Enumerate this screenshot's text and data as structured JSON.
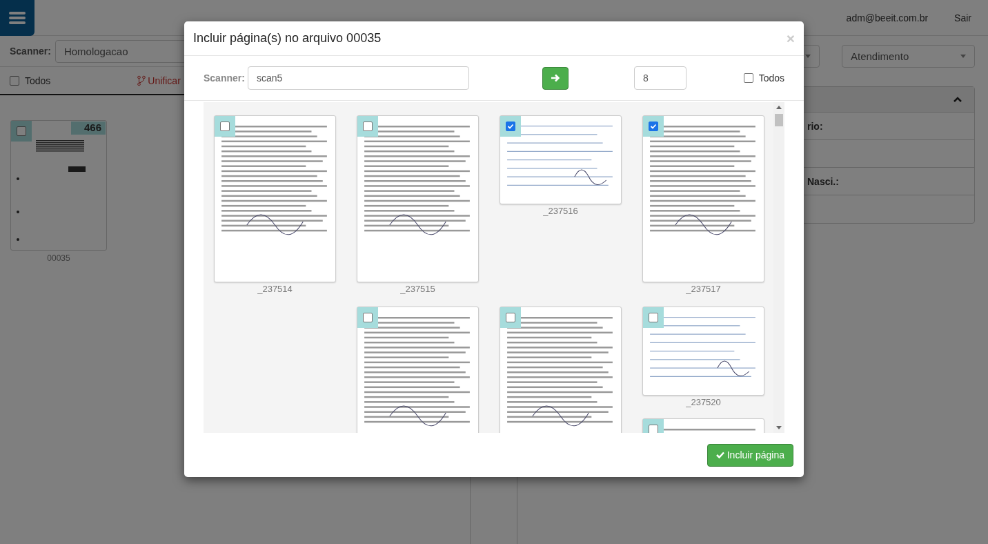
{
  "header": {
    "user": "adm@beeit.com.br",
    "logout": "Sair"
  },
  "left": {
    "scanner_label": "Scanner:",
    "scanner_value": "Homologacao",
    "select_all": {
      "label": "Todos",
      "checked": false
    },
    "merge_link": "Unificar",
    "files": [
      {
        "count": "466",
        "label": "00035",
        "checked": false
      }
    ]
  },
  "right": {
    "select_2": "Atendimento",
    "panel_rows": [
      "rio:",
      "",
      "Nasci.:",
      ""
    ]
  },
  "modal": {
    "title": "Incluir página(s) no arquivo 00035",
    "close": "×",
    "scanner_label": "Scanner:",
    "scanner_value": "scan5",
    "count_value": "8",
    "select_all": {
      "label": "Todos",
      "checked": false
    },
    "columns": [
      {
        "pages": [
          {
            "label": "_237514",
            "checked": false,
            "kind": "portrait"
          }
        ]
      },
      {
        "pages": [
          {
            "label": "_237515",
            "checked": false,
            "kind": "portrait"
          },
          {
            "checked": false,
            "kind": "portrait"
          }
        ]
      },
      {
        "pages": [
          {
            "label": "_237516",
            "checked": true,
            "kind": "landscape"
          },
          {
            "checked": false,
            "kind": "portrait"
          }
        ]
      },
      {
        "pages": [
          {
            "label": "_237517",
            "checked": true,
            "kind": "portrait"
          },
          {
            "label": "_237520",
            "checked": false,
            "kind": "landscape"
          },
          {
            "checked": false,
            "kind": "portrait"
          }
        ]
      }
    ],
    "submit": "Incluir página"
  }
}
